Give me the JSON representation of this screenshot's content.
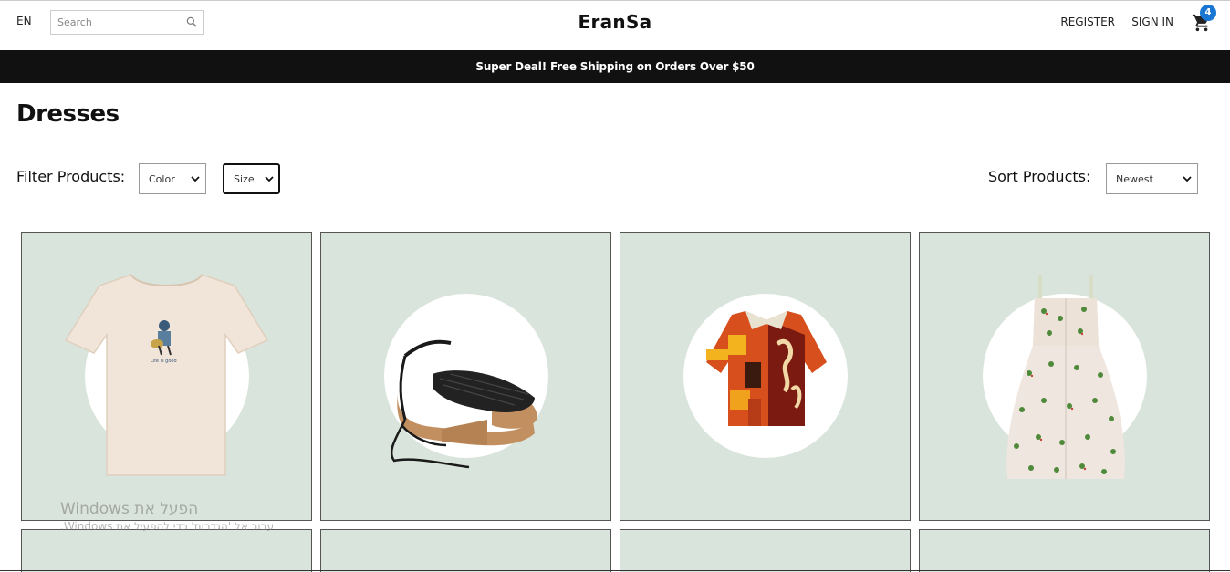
{
  "navbar": {
    "language": "EN",
    "search_placeholder": "Search",
    "logo": "EranSa",
    "register": "REGISTER",
    "sign_in": "SIGN IN",
    "cart_count": "4"
  },
  "announcement": "Super Deal! Free Shipping on Orders Over $50",
  "page": {
    "title": "Dresses",
    "filter_label": "Filter Products:",
    "sort_label": "Sort Products:",
    "color_select": "Color",
    "size_select": "Size",
    "sort_select": "Newest"
  },
  "products": [
    {
      "name": "t-shirt",
      "icon": "tshirt-image"
    },
    {
      "name": "platform-sandals",
      "icon": "sandal-image"
    },
    {
      "name": "printed-shirt",
      "icon": "shirt-image"
    },
    {
      "name": "floral-dress",
      "icon": "dress-image"
    }
  ],
  "watermark": {
    "line1": "הפעל את Windows",
    "line2": "עבור אל 'הגדרות' כדי להפעיל את Windows."
  },
  "colors": {
    "card_bg": "#d9e4dc",
    "announcement_bg": "#111111",
    "badge": "#1976d2"
  }
}
